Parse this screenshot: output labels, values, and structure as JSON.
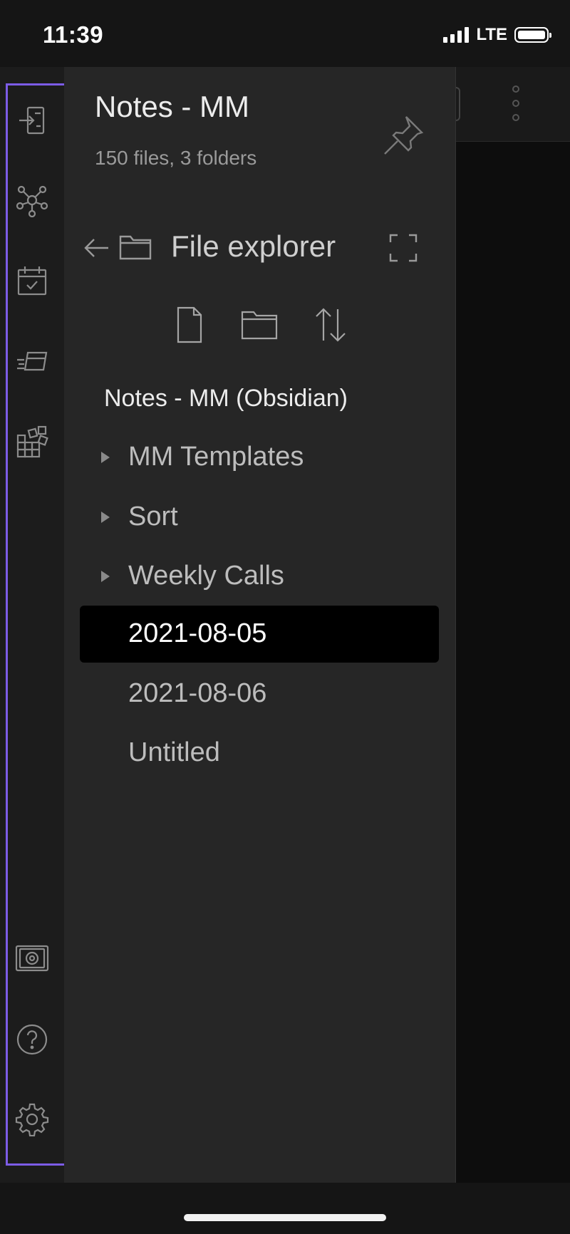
{
  "status_bar": {
    "time": "11:39",
    "network": "LTE",
    "signal_bars": 4,
    "battery_level": 0.9
  },
  "ribbon": {
    "items": [
      {
        "icon": "import-icon"
      },
      {
        "icon": "graph-view-icon"
      },
      {
        "icon": "calendar-check-icon"
      },
      {
        "icon": "slides-icon"
      },
      {
        "icon": "blocks-icon"
      }
    ],
    "bottom_items": [
      {
        "icon": "vault-icon"
      },
      {
        "icon": "help-icon"
      },
      {
        "icon": "settings-icon"
      }
    ],
    "highlight_color": "#7c5ce6"
  },
  "drawer": {
    "vault_name": "Notes - MM",
    "vault_stats": "150 files, 3 folders",
    "pin_icon": "pin-icon"
  },
  "file_explorer": {
    "title": "File explorer",
    "toolbar": [
      "new-note-icon",
      "new-folder-icon",
      "sort-icon"
    ],
    "root_name": "Notes - MM (Obsidian)",
    "items": [
      {
        "label": "MM Templates",
        "type": "folder",
        "active": false
      },
      {
        "label": "Sort",
        "type": "folder",
        "active": false
      },
      {
        "label": "Weekly Calls",
        "type": "folder",
        "active": false
      },
      {
        "label": "2021-08-05",
        "type": "file",
        "active": true
      },
      {
        "label": "2021-08-06",
        "type": "file",
        "active": false
      },
      {
        "label": "Untitled",
        "type": "file",
        "active": false
      }
    ]
  },
  "colors": {
    "background": "#151515",
    "drawer": "#262626",
    "ribbon": "#1c1c1c",
    "active_row": "#000000"
  }
}
